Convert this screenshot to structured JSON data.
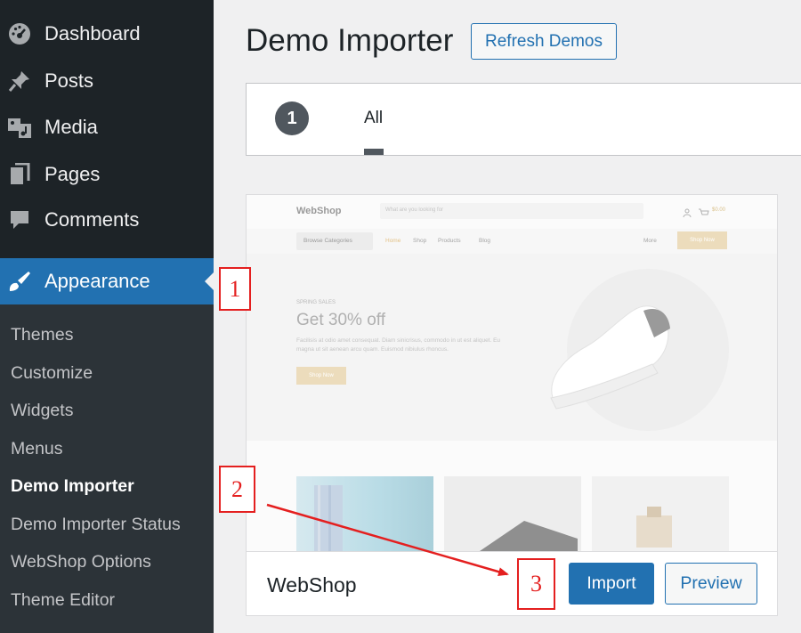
{
  "sidebar": {
    "menu": [
      {
        "label": "Dashboard",
        "icon": "dashboard-icon"
      },
      {
        "label": "Posts",
        "icon": "pin-icon"
      },
      {
        "label": "Media",
        "icon": "media-icon"
      },
      {
        "label": "Pages",
        "icon": "pages-icon"
      },
      {
        "label": "Comments",
        "icon": "comments-icon"
      },
      {
        "label": "Appearance",
        "icon": "brush-icon",
        "active": true
      }
    ],
    "submenu": [
      "Themes",
      "Customize",
      "Widgets",
      "Menus",
      "Demo Importer",
      "Demo Importer Status",
      "WebShop Options",
      "Theme Editor"
    ],
    "current_submenu": "Demo Importer"
  },
  "header": {
    "title": "Demo Importer",
    "refresh_label": "Refresh Demos"
  },
  "filter": {
    "count": "1",
    "tab_all": "All"
  },
  "theme": {
    "name": "WebShop",
    "import_label": "Import",
    "preview_label": "Preview",
    "screenshot": {
      "logo": "WebShop",
      "search_placeholder": "What are you looking for",
      "browse_categories": "Browse Categories",
      "nav": [
        "Home",
        "Shop",
        "Products",
        "Blog"
      ],
      "more": "More",
      "shop_now_top": "Shop Now",
      "cart_amount": "$0.00",
      "sale_label": "SPRING SALES",
      "headline": "Get 30% off",
      "body": "Facilisis at odio amet consequat. Diam sinicrisus, commodo in ut est aliquet. Eu magna ut sit aenean arcu quam. Euismod nibiulus rhoncus.",
      "shop_now_hero": "Shop Now"
    }
  },
  "annotations": [
    "1",
    "2",
    "3"
  ],
  "colors": {
    "sidebar_bg": "#1d2327",
    "accent": "#2271b1",
    "annotation_red": "#e41f1f"
  }
}
